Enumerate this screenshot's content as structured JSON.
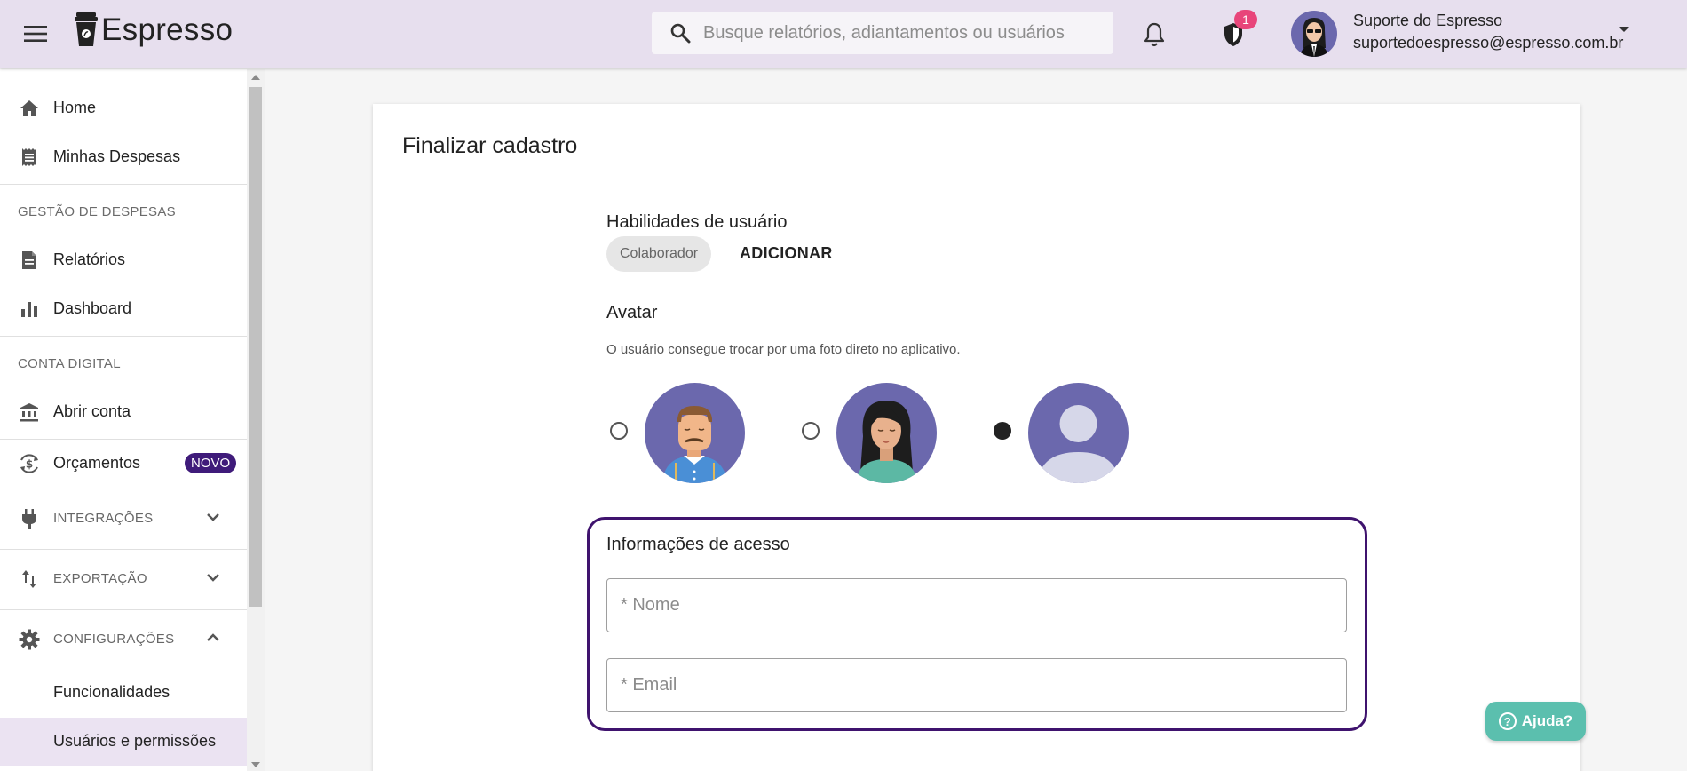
{
  "header": {
    "app_name": "Espresso",
    "search_placeholder": "Busque relatórios, adiantamentos ou usuários",
    "security_badge_count": "1",
    "user_name": "Suporte do Espresso",
    "user_email": "suportedoespresso@espresso.com.br"
  },
  "sidebar": {
    "home": "Home",
    "minhas_despesas": "Minhas Despesas",
    "section_gestao": "GESTÃO DE DESPESAS",
    "relatorios": "Relatórios",
    "dashboard": "Dashboard",
    "section_conta": "CONTA DIGITAL",
    "abrir_conta": "Abrir conta",
    "orcamentos": "Orçamentos",
    "novo_badge": "NOVO",
    "integracoes": "INTEGRAÇÕES",
    "exportacao": "EXPORTAÇÃO",
    "configuracoes": "CONFIGURAÇÕES",
    "funcionalidades": "Funcionalidades",
    "usuarios_permissoes": "Usuários e permissões"
  },
  "main": {
    "title": "Finalizar cadastro",
    "skills_label": "Habilidades de usuário",
    "skill_chip": "Colaborador",
    "add_button": "ADICIONAR",
    "avatar_label": "Avatar",
    "avatar_hint": "O usuário consegue trocar por uma foto direto no aplicativo.",
    "avatar_selected": "default",
    "access_title": "Informações de acesso",
    "name_placeholder": "* Nome",
    "email_placeholder": "* Email"
  },
  "help": {
    "label": "Ajuda?"
  },
  "colors": {
    "accent": "#3f136e",
    "header_bg": "#e7dfee",
    "avatar_bg": "#6b68ad",
    "help_bg": "#5bbfae",
    "badge": "#e8457a"
  }
}
